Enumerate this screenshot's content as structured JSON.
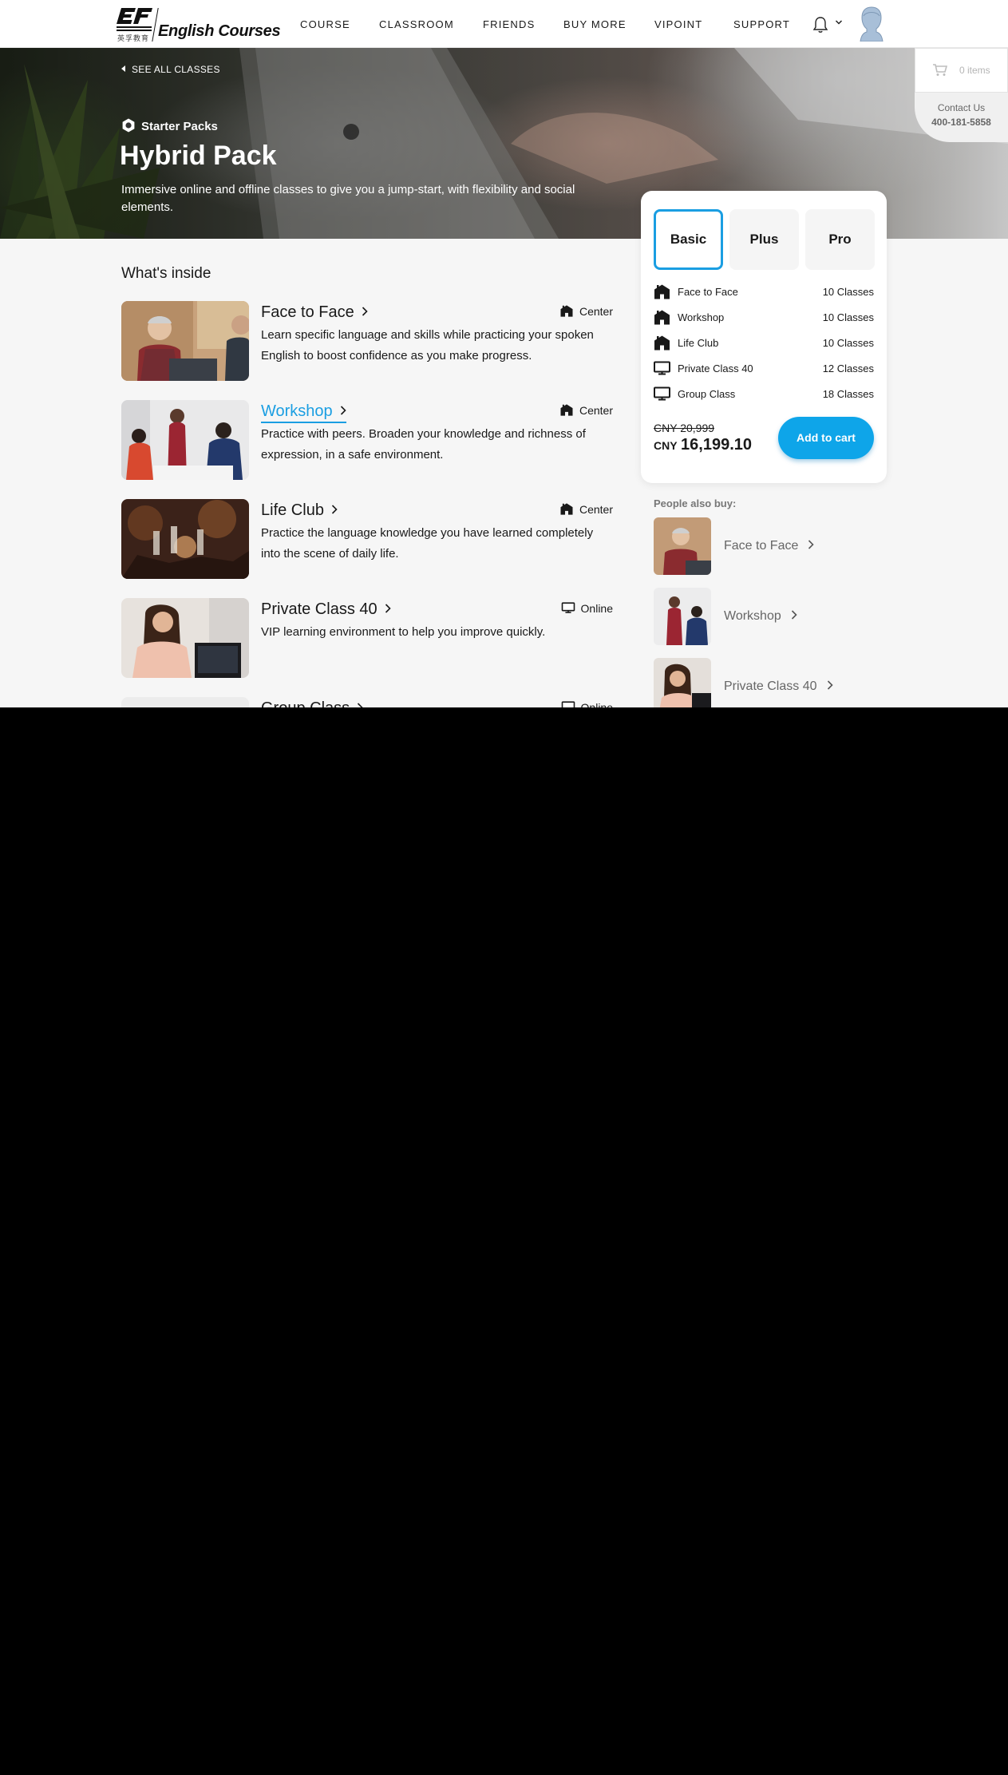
{
  "header": {
    "logo_text": "English Courses",
    "logo_mark": "EF",
    "logo_sub": "英孚教育",
    "nav": [
      {
        "label": "COURSE"
      },
      {
        "label": "CLASSROOM"
      },
      {
        "label": "FRIENDS"
      },
      {
        "label": "BUY MORE"
      },
      {
        "label": "VIPOINT"
      },
      {
        "label": "SUPPORT"
      }
    ],
    "icons": {
      "notification": "bell-icon",
      "dropdown": "chevron-down-icon",
      "profile": "avatar"
    }
  },
  "cart": {
    "icon": "cart-icon",
    "count_label": "0 items",
    "contact_label": "Contact Us",
    "phone": "400-181-5858"
  },
  "hero": {
    "back_link": "SEE ALL CLASSES",
    "category": "Starter Packs",
    "title": "Hybrid Pack",
    "description": "Immersive online and offline classes to give you a jump-start, with flexibility and social elements."
  },
  "inside": {
    "title": "What's inside",
    "courses": [
      {
        "name": "Face to Face",
        "type": "Center",
        "type_icon": "center-icon",
        "description": "Learn specific language and skills while practicing your spoken English to boost confidence as you make progress."
      },
      {
        "name": "Workshop",
        "type": "Center",
        "type_icon": "center-icon",
        "description": "Practice with peers. Broaden your knowledge and richness of expression, in a safe environment."
      },
      {
        "name": "Life Club",
        "type": "Center",
        "type_icon": "center-icon",
        "description": "Practice the language knowledge you have learned completely into the scene of daily life."
      },
      {
        "name": "Private Class 40",
        "type": "Online",
        "type_icon": "monitor-icon",
        "description": "VIP learning environment to help you improve quickly."
      },
      {
        "name": "Group Class",
        "type": "Online",
        "type_icon": "monitor-icon",
        "description": ""
      }
    ]
  },
  "pricing": {
    "tiers": [
      {
        "label": "Basic",
        "selected": true
      },
      {
        "label": "Plus",
        "selected": false
      },
      {
        "label": "Pro",
        "selected": false
      }
    ],
    "includes": [
      {
        "name": "Face to Face",
        "count": "10 Classes",
        "icon": "center-icon"
      },
      {
        "name": "Workshop",
        "count": "10 Classes",
        "icon": "center-icon"
      },
      {
        "name": "Life Club",
        "count": "10 Classes",
        "icon": "center-icon"
      },
      {
        "name": "Private Class 40",
        "count": "12 Classes",
        "icon": "monitor-icon"
      },
      {
        "name": "Group Class",
        "count": "18 Classes",
        "icon": "monitor-icon"
      }
    ],
    "old_price": "CNY 20,999",
    "currency": "CNY",
    "new_price": "16,199.10",
    "cta": "Add to cart"
  },
  "also_buy": {
    "title": "People also buy:",
    "items": [
      {
        "label": "Face to Face"
      },
      {
        "label": "Workshop"
      },
      {
        "label": "Private Class 40"
      }
    ]
  },
  "colors": {
    "accent": "#1a9ee2",
    "cta": "#0ea5e9",
    "page_bg": "#f6f6f6",
    "text": "#191919"
  }
}
